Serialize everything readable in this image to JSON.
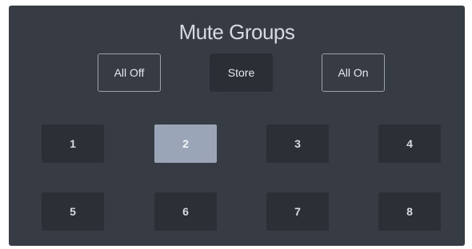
{
  "panel": {
    "title": "Mute Groups"
  },
  "controls": {
    "all_off_label": "All Off",
    "store_label": "Store",
    "all_on_label": "All On"
  },
  "groups": {
    "active": "2",
    "items": [
      {
        "label": "1"
      },
      {
        "label": "2"
      },
      {
        "label": "3"
      },
      {
        "label": "4"
      },
      {
        "label": "5"
      },
      {
        "label": "6"
      },
      {
        "label": "7"
      },
      {
        "label": "8"
      }
    ]
  },
  "colors": {
    "panel_bg": "#363b44",
    "button_bg": "#2b2f36",
    "active_bg": "#9aa6b8",
    "outline": "#9aa1ac"
  }
}
